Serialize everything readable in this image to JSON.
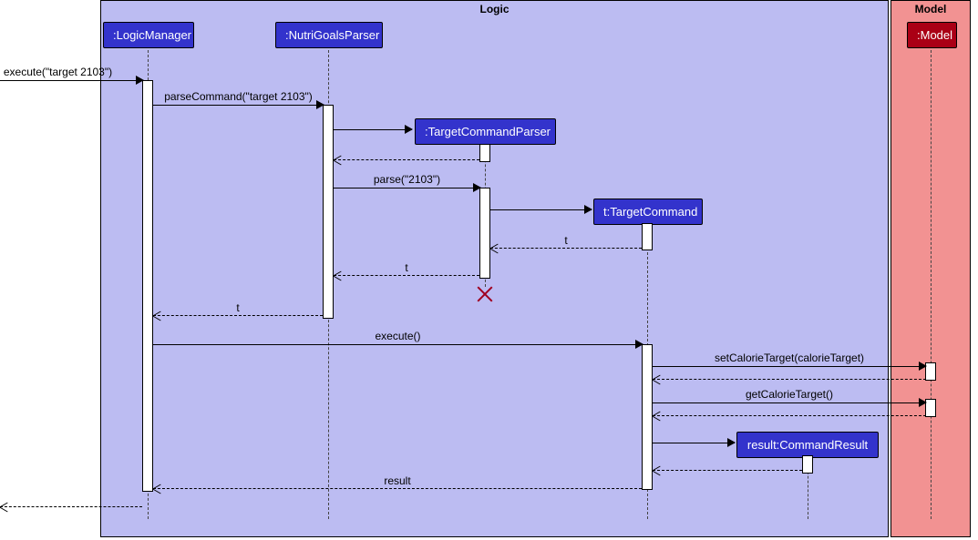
{
  "frames": {
    "logic": "Logic",
    "model": "Model"
  },
  "participants": {
    "logicManager": ":LogicManager",
    "nutriGoalsParser": ":NutriGoalsParser",
    "targetCommandParser": ":TargetCommandParser",
    "targetCommand": "t:TargetCommand",
    "commandResult": "result:CommandResult",
    "model": ":Model"
  },
  "messages": {
    "m1": "execute(\"target 2103\")",
    "m2": "parseCommand(\"target 2103\")",
    "m3": "parse(\"2103\")",
    "m4": "t",
    "m5": "t",
    "m6": "t",
    "m7": "execute()",
    "m8": "setCalorieTarget(calorieTarget)",
    "m9": "getCalorieTarget()",
    "m10": "result"
  }
}
